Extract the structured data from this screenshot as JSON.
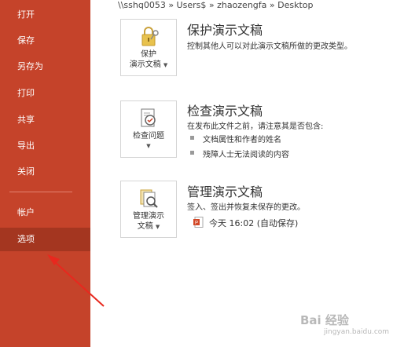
{
  "sidebar": {
    "items": [
      {
        "label": "打开"
      },
      {
        "label": "保存"
      },
      {
        "label": "另存为"
      },
      {
        "label": "打印"
      },
      {
        "label": "共享"
      },
      {
        "label": "导出"
      },
      {
        "label": "关闭"
      },
      {
        "label": "帐户"
      },
      {
        "label": "选项"
      }
    ],
    "selected": "选项"
  },
  "path": "\\\\sshq0053 » Users$ » zhaozengfa » Desktop",
  "sections": {
    "protect": {
      "button_line1": "保护",
      "button_line2": "演示文稿",
      "title": "保护演示文稿",
      "description": "控制其他人可以对此演示文稿所做的更改类型。"
    },
    "inspect": {
      "button_label": "检查问题",
      "title": "检查演示文稿",
      "description": "在发布此文件之前，请注意其是否包含:",
      "bullets": [
        "文档属性和作者的姓名",
        "残障人士无法阅读的内容"
      ]
    },
    "manage": {
      "button_line1": "管理演示",
      "button_line2": "文稿",
      "title": "管理演示文稿",
      "description": "签入、签出并恢复未保存的更改。",
      "version": "今天 16:02 (自动保存)"
    }
  },
  "watermark": {
    "text": "Bai 经验",
    "sub": "jingyan.baidu.com"
  },
  "colors": {
    "sidebar": "#c5432a",
    "selected": "#a43620",
    "arrow": "#e8281e"
  }
}
